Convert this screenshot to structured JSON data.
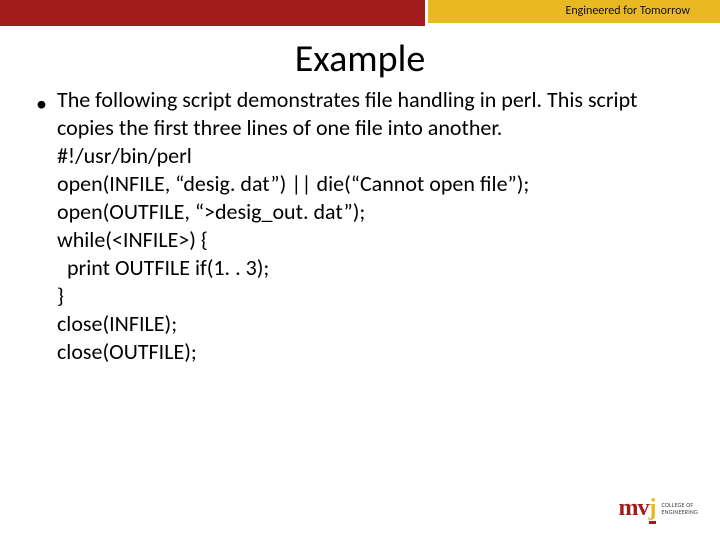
{
  "header": {
    "tagline": "Engineered for Tomorrow"
  },
  "slide": {
    "title": "Example",
    "intro": "The following script demonstrates file handling in perl. This script copies the first three lines of one file into another.",
    "code_lines": [
      "#!/usr/bin/perl",
      "open(INFILE, “desig. dat”) || die(“Cannot open file”);",
      "open(OUTFILE, “>desig_out. dat”);",
      "while(<INFILE>) {",
      "  print OUTFILE if(1. . 3);",
      "}",
      "close(INFILE);",
      "close(OUTFILE);"
    ]
  },
  "footer": {
    "logo_primary": "mvj",
    "logo_secondary_line1": "COLLEGE OF",
    "logo_secondary_line2": "ENGINEERING"
  }
}
